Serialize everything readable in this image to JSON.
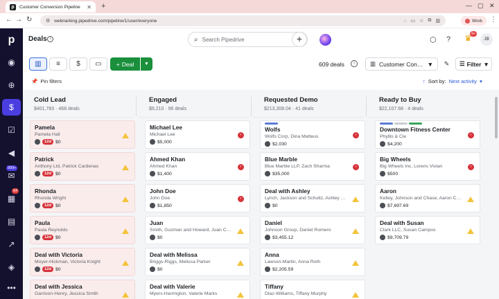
{
  "browser": {
    "tab_title": "Customer Conversion Pipeline",
    "url": "webnarking.pipedrive.com/pipeline/1/user/everyone",
    "profile_label": "Work"
  },
  "nav": {
    "badges": {
      "mail": "999+",
      "activities": "64"
    }
  },
  "header": {
    "title": "Deals",
    "search_placeholder": "Search Pipedrive",
    "avatar_initials": "JB",
    "notif_count": "9+"
  },
  "toolbar": {
    "deal_button_label": "Deal",
    "deal_count": "609 deals",
    "pipeline_name": "Customer Con…",
    "filter_label": "Filter",
    "pin_filters_label": "Pin filters",
    "sort_prefix": "Sort by:",
    "sort_value": "Next activity"
  },
  "columns": [
    {
      "name": "Cold Lead",
      "meta": "$401,783 · 468 deals",
      "cards": [
        {
          "title": "Pamela",
          "sub": "Pamela Hall",
          "age": "12d",
          "value": "$0",
          "stale": true,
          "flag": "warn"
        },
        {
          "title": "Patrick",
          "sub": "Anthony Ltd, Patrick Cardenas",
          "age": "12d",
          "value": "$0",
          "stale": true,
          "flag": "warn"
        },
        {
          "title": "Rhonda",
          "sub": "Rhonda Wright",
          "age": "12d",
          "value": "$0",
          "stale": true,
          "flag": "warn"
        },
        {
          "title": "Paula",
          "sub": "Paula Reynolds",
          "age": "12d",
          "value": "$0",
          "stale": true,
          "flag": "warn"
        },
        {
          "title": "Deal with Victoria",
          "sub": "Moyer-Hickman, Victoria Knight",
          "age": "12d",
          "value": "$0",
          "stale": true,
          "flag": "warn"
        },
        {
          "title": "Deal with Jessica",
          "sub": "Garrison-Henry, Jessica Smith",
          "age": "",
          "value": "",
          "stale": true,
          "flag": "warn"
        }
      ]
    },
    {
      "name": "Engaged",
      "meta": "$9,210 · 96 deals",
      "cards": [
        {
          "title": "Michael Lee",
          "sub": "Michael Lee",
          "age": "",
          "value": "$5,000",
          "stale": false,
          "flag": "red"
        },
        {
          "title": "Ahmed Khan",
          "sub": "Ahmed Khan",
          "age": "",
          "value": "$1,400",
          "stale": false,
          "flag": "red"
        },
        {
          "title": "John Doe",
          "sub": "John Doe",
          "age": "",
          "value": "$1,850",
          "stale": false,
          "flag": "red"
        },
        {
          "title": "Juan",
          "sub": "Smith, Guzman and Howard, Juan C…",
          "age": "",
          "value": "$0",
          "stale": false,
          "flag": "warn"
        },
        {
          "title": "Deal with Melissa",
          "sub": "Briggs-Riggs, Melissa Parker",
          "age": "",
          "value": "$0",
          "stale": false,
          "flag": "warn"
        },
        {
          "title": "Deal with Valerie",
          "sub": "Myers-Harrington, Valerie Marks",
          "age": "",
          "value": "",
          "stale": false,
          "flag": "warn"
        }
      ]
    },
    {
      "name": "Requested Demo",
      "meta": "$213,308.04 · 41 deals",
      "cards": [
        {
          "title": "Wolfs",
          "sub": "Wolfs Corp, Dina Matteus",
          "age": "",
          "value": "$2,030",
          "stale": false,
          "flag": "red",
          "bars": [
            "#5b7bd5"
          ]
        },
        {
          "title": "Blue Marble",
          "sub": "Blue Marble LLP, Zach Sharma",
          "age": "",
          "value": "$35,000",
          "stale": false,
          "flag": "red"
        },
        {
          "title": "Deal with Ashley",
          "sub": "Lynch, Jackson and Schultz, Ashley …",
          "age": "",
          "value": "$0",
          "stale": false,
          "flag": "warn"
        },
        {
          "title": "Daniel",
          "sub": "Johnson Group, Daniel Romero",
          "age": "",
          "value": "$3,455.12",
          "stale": false,
          "flag": "warn"
        },
        {
          "title": "Anna",
          "sub": "Lawson-Martin, Anna Roth",
          "age": "",
          "value": "$2,205.59",
          "stale": false,
          "flag": "warn"
        },
        {
          "title": "Tiffany",
          "sub": "Diaz-Williams, Tiffany Murphy",
          "age": "",
          "value": "",
          "stale": false,
          "flag": "warn"
        }
      ]
    },
    {
      "name": "Ready to Buy",
      "meta": "$22,107.68 · 4 deals",
      "cards": [
        {
          "title": "Downtown Fitness Center",
          "sub": "Phyllis & Cie",
          "age": "",
          "value": "$4,200",
          "stale": false,
          "flag": "red",
          "bars": [
            "#5b7bd5",
            "#c9ccd1",
            "#3aa55a"
          ]
        },
        {
          "title": "Big Wheels",
          "sub": "Big Wheels Inc, Lorens Vivian",
          "age": "",
          "value": "$500",
          "stale": false,
          "flag": "red"
        },
        {
          "title": "Aaron",
          "sub": "Kelley, Johnson and Chase, Aaron C…",
          "age": "",
          "value": "$7,697.69",
          "stale": false,
          "flag": "warn"
        },
        {
          "title": "Deal with Susan",
          "sub": "Clark LLC, Susan Campos",
          "age": "",
          "value": "$9,709.79",
          "stale": false,
          "flag": "warn"
        }
      ]
    }
  ],
  "colors": {
    "accent": "#4b3ee0",
    "deal_green": "#1a8f3c",
    "nav_bg": "#13112e",
    "stale_red": "#d6333a",
    "warn_yellow": "#f3c33b"
  }
}
